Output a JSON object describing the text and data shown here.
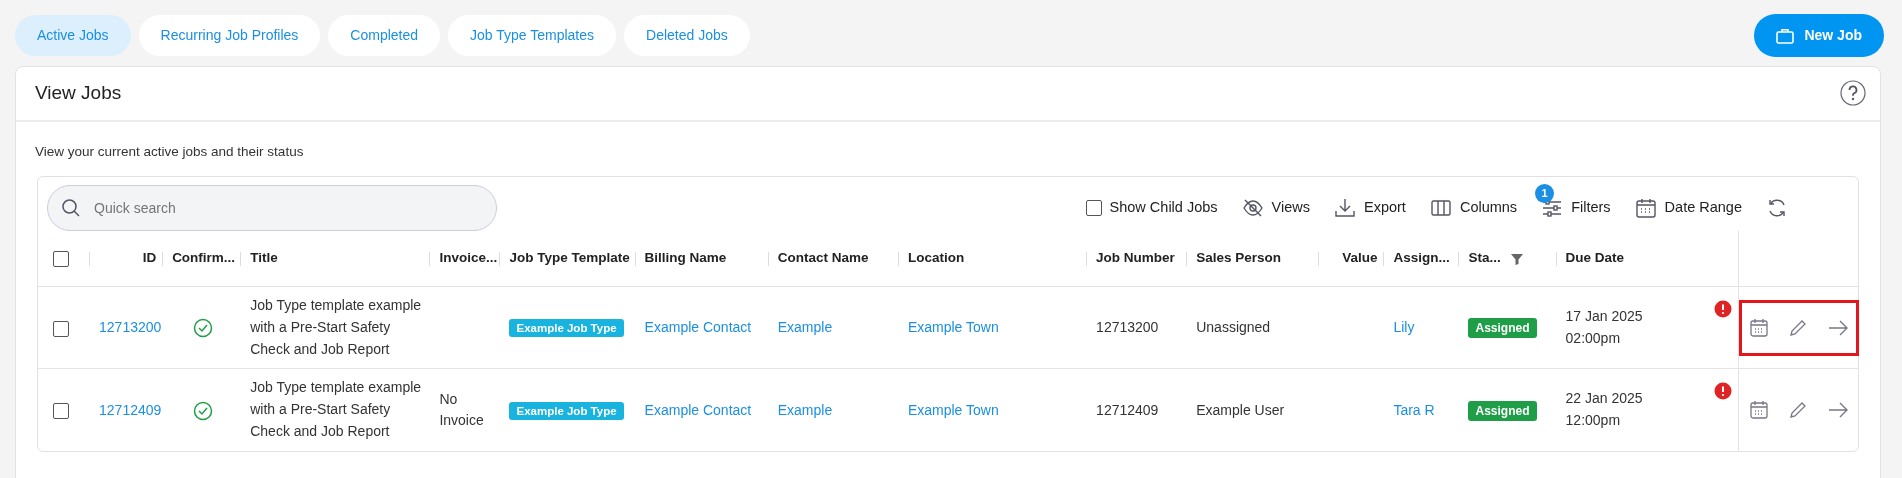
{
  "tabs": [
    {
      "label": "Active Jobs",
      "selected": true
    },
    {
      "label": "Recurring Job Profiles",
      "selected": false
    },
    {
      "label": "Completed",
      "selected": false
    },
    {
      "label": "Job Type Templates",
      "selected": false
    },
    {
      "label": "Deleted Jobs",
      "selected": false
    }
  ],
  "new_job_button": "New Job",
  "card": {
    "title": "View Jobs",
    "description": "View your current active jobs and their status"
  },
  "toolbar": {
    "search": {
      "placeholder": "Quick search"
    },
    "show_child_jobs": {
      "label": "Show Child Jobs",
      "checked": false
    },
    "actions": [
      {
        "kind": "views",
        "label": "Views"
      },
      {
        "kind": "export",
        "label": "Export"
      },
      {
        "kind": "columns",
        "label": "Columns"
      },
      {
        "kind": "filters",
        "label": "Filters",
        "badge": "1"
      },
      {
        "kind": "date_range",
        "label": "Date Range"
      }
    ]
  },
  "table": {
    "select_all_checked": false,
    "columns": [
      {
        "label": "ID",
        "filter": false
      },
      {
        "label": "Confirm...",
        "filter": false
      },
      {
        "label": "Title",
        "filter": false
      },
      {
        "label": "Invoice...",
        "filter": false
      },
      {
        "label": "Job Type Template",
        "filter": false
      },
      {
        "label": "Billing Name",
        "filter": false
      },
      {
        "label": "Contact Name",
        "filter": false
      },
      {
        "label": "Location",
        "filter": false
      },
      {
        "label": "Job Number",
        "filter": false
      },
      {
        "label": "Sales Person",
        "filter": false
      },
      {
        "label": "Value",
        "filter": false
      },
      {
        "label": "Assign...",
        "filter": false
      },
      {
        "label": "Sta...",
        "filter": true
      },
      {
        "label": "Due Date",
        "filter": false
      }
    ],
    "rows": [
      {
        "checked": false,
        "id": "12713200",
        "confirmed": true,
        "title": "Job Type template example with a Pre-Start Safety Check and Job Report",
        "job_type": "Example Job Type",
        "billing_name": "Example Contact",
        "contact_name": "Example",
        "location": "Example Town",
        "job_number": "12713200",
        "sales_person": "Unassigned",
        "assigned_to": "Lily",
        "status": "Assigned",
        "due_date": "17 Jan 2025",
        "due_time": "02:00pm",
        "overdue": true,
        "highlighted": true
      },
      {
        "checked": false,
        "id": "12712409",
        "confirmed": true,
        "title": "Job Type template example with a Pre-Start Safety Check and Job Report",
        "invoice": "No Invoice",
        "job_type": "Example Job Type",
        "billing_name": "Example Contact",
        "contact_name": "Example",
        "location": "Example Town",
        "job_number": "12712409",
        "sales_person": "Example User",
        "assigned_to": "Tara R",
        "status": "Assigned",
        "due_date": "22 Jan 2025",
        "due_time": "12:00pm",
        "overdue": true,
        "highlighted": false
      }
    ]
  }
}
